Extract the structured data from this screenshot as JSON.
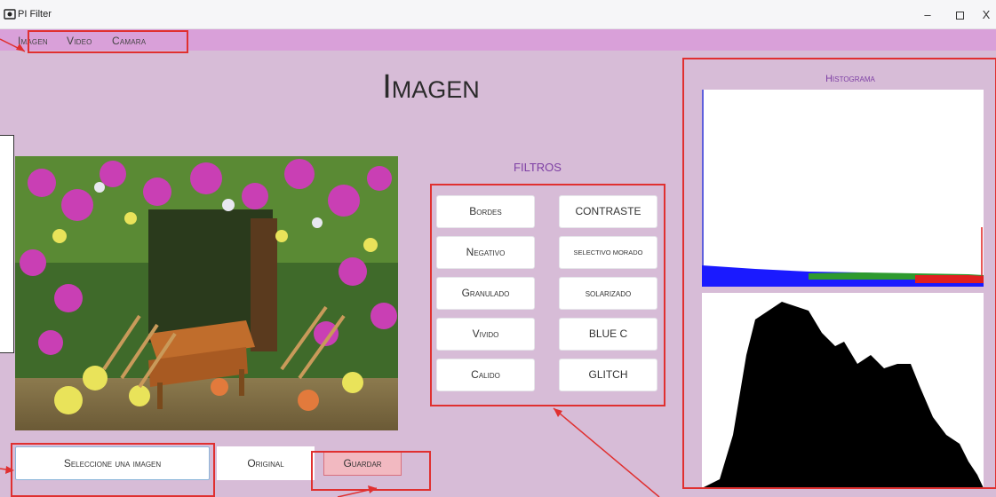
{
  "window": {
    "title": "PI Filter",
    "minimize": "–",
    "close": "X"
  },
  "menu": {
    "items": [
      "Imagen",
      "Video",
      "Camara"
    ]
  },
  "page": {
    "title": "Imagen"
  },
  "filters": {
    "label": "FILTROS",
    "buttons": [
      "Bordes",
      "CONTRASTE",
      "Negativo",
      "SELECTIVO MORADO",
      "Granulado",
      "solarizado",
      "Vivido",
      "BLUE C",
      "Calido",
      "GLITCH"
    ]
  },
  "histogram": {
    "label": "Histograma"
  },
  "actions": {
    "select": "Seleccione una imagen",
    "original": "Original",
    "save": "Guardar"
  },
  "colors": {
    "menubar": "#d9a0d9",
    "background": "#d7bcd7",
    "accent": "#7d3fa4",
    "save": "#f2b9c1",
    "annotation": "#e03030"
  }
}
